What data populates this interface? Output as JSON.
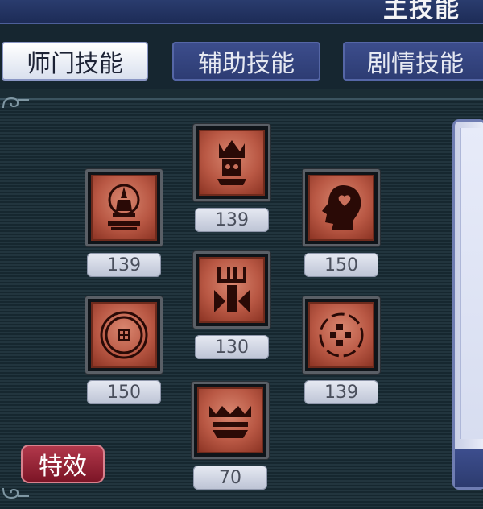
{
  "window": {
    "title": "主技能"
  },
  "tabs": [
    {
      "label": "师门技能",
      "active": true
    },
    {
      "label": "辅助技能",
      "active": false
    },
    {
      "label": "剧情技能",
      "active": false
    }
  ],
  "skills": [
    {
      "icon": "crowned-figure-icon",
      "level": "139"
    },
    {
      "icon": "pagoda-halo-icon",
      "level": "139"
    },
    {
      "icon": "head-profile-icon",
      "level": "150"
    },
    {
      "icon": "trident-totem-icon",
      "level": "130"
    },
    {
      "icon": "round-seal-icon",
      "level": "150"
    },
    {
      "icon": "circle-dots-icon",
      "level": "139"
    },
    {
      "icon": "crown-band-icon",
      "level": "70"
    }
  ],
  "effects_button": {
    "label": "特效"
  },
  "colors": {
    "skill_face": "#b95844",
    "tab_active": "#ffffff",
    "tab_inactive": "#3c4d8c",
    "effects_button": "#9a2236"
  }
}
